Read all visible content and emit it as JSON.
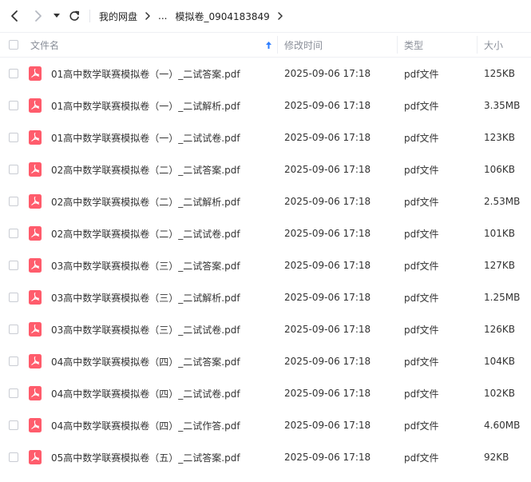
{
  "toolbar": {
    "back_icon": "chevron-left-icon",
    "forward_icon": "chevron-right-icon",
    "dropdown_icon": "caret-down-icon",
    "refresh_icon": "refresh-icon",
    "breadcrumb": {
      "root": "我的网盘",
      "ellipsis": "...",
      "current": "模拟卷_0904183849"
    }
  },
  "columns": {
    "name": "文件名",
    "sort_icon": "sort-up-arrow-icon",
    "modified": "修改时间",
    "type": "类型",
    "size": "大小"
  },
  "colors": {
    "accent": "#2b7cff",
    "pdf_icon": "#ff5c6c",
    "header_text": "#8a8f99"
  },
  "files": [
    {
      "name": "01高中数学联赛模拟卷（一）_二试答案.pdf",
      "modified": "2025-09-06 17:18",
      "type": "pdf文件",
      "size": "125KB"
    },
    {
      "name": "01高中数学联赛模拟卷（一）_二试解析.pdf",
      "modified": "2025-09-06 17:18",
      "type": "pdf文件",
      "size": "3.35MB"
    },
    {
      "name": "01高中数学联赛模拟卷（一）_二试试卷.pdf",
      "modified": "2025-09-06 17:18",
      "type": "pdf文件",
      "size": "123KB"
    },
    {
      "name": "02高中数学联赛模拟卷（二）_二试答案.pdf",
      "modified": "2025-09-06 17:18",
      "type": "pdf文件",
      "size": "106KB"
    },
    {
      "name": "02高中数学联赛模拟卷（二）_二试解析.pdf",
      "modified": "2025-09-06 17:18",
      "type": "pdf文件",
      "size": "2.53MB"
    },
    {
      "name": "02高中数学联赛模拟卷（二）_二试试卷.pdf",
      "modified": "2025-09-06 17:18",
      "type": "pdf文件",
      "size": "101KB"
    },
    {
      "name": "03高中数学联赛模拟卷（三）_二试答案.pdf",
      "modified": "2025-09-06 17:18",
      "type": "pdf文件",
      "size": "127KB"
    },
    {
      "name": "03高中数学联赛模拟卷（三）_二试解析.pdf",
      "modified": "2025-09-06 17:18",
      "type": "pdf文件",
      "size": "1.25MB"
    },
    {
      "name": "03高中数学联赛模拟卷（三）_二试试卷.pdf",
      "modified": "2025-09-06 17:18",
      "type": "pdf文件",
      "size": "126KB"
    },
    {
      "name": "04高中数学联赛模拟卷（四）_二试答案.pdf",
      "modified": "2025-09-06 17:18",
      "type": "pdf文件",
      "size": "104KB"
    },
    {
      "name": "04高中数学联赛模拟卷（四）_二试试卷.pdf",
      "modified": "2025-09-06 17:18",
      "type": "pdf文件",
      "size": "102KB"
    },
    {
      "name": "04高中数学联赛模拟卷（四）_二试作答.pdf",
      "modified": "2025-09-06 17:18",
      "type": "pdf文件",
      "size": "4.60MB"
    },
    {
      "name": "05高中数学联赛模拟卷（五）_二试答案.pdf",
      "modified": "2025-09-06 17:18",
      "type": "pdf文件",
      "size": "92KB"
    }
  ]
}
